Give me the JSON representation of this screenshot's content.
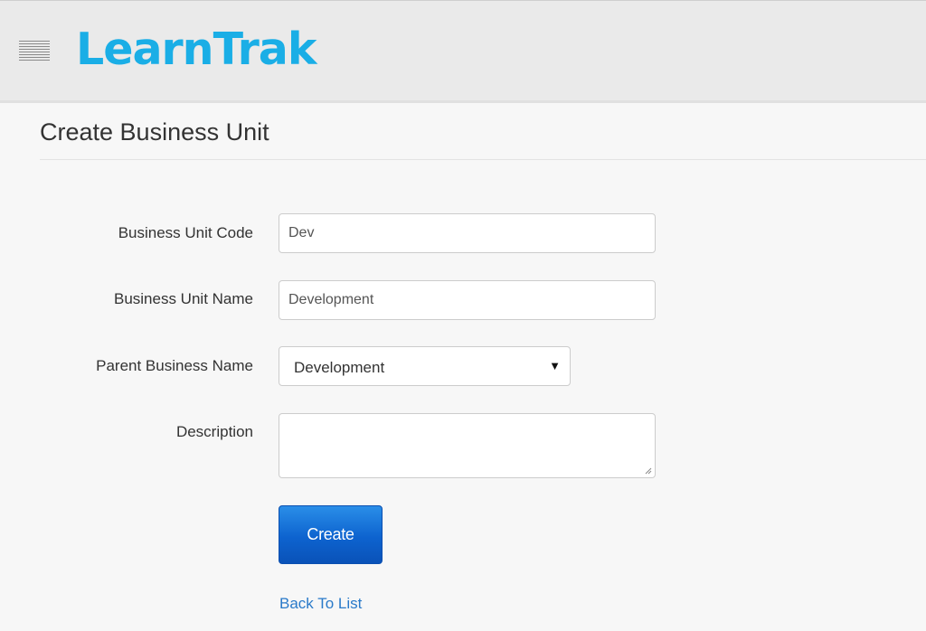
{
  "header": {
    "logo_text": "LearnTrak",
    "menu_icon": "hamburger-menu-icon"
  },
  "page": {
    "title": "Create Business Unit"
  },
  "form": {
    "code_label": "Business Unit Code",
    "code_value": "Dev",
    "name_label": "Business Unit Name",
    "name_value": "Development",
    "parent_label": "Parent Business Name",
    "parent_value": "Development",
    "parent_arrow": "▼",
    "description_label": "Description",
    "description_value": "",
    "create_label": "Create",
    "back_label": "Back To List"
  },
  "colors": {
    "logo": "#1aaee6",
    "primary_button": "#0d63cf",
    "link": "#2a7ac9",
    "header_bg": "#eaeaea",
    "page_bg": "#f7f7f7"
  }
}
